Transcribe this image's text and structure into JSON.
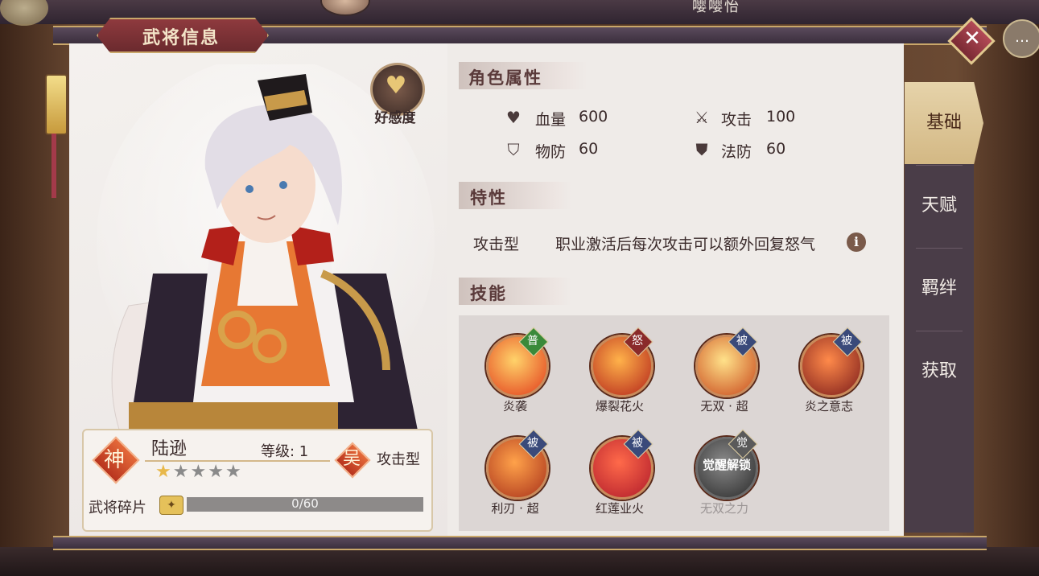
{
  "window": {
    "title": "武将信息",
    "top_name": "嘤嘤怡"
  },
  "hero": {
    "favor_label": "好感度",
    "rank_char": "神",
    "name": "陆逊",
    "level_text": "等级: 1",
    "stars_total": 5,
    "stars_filled": 1,
    "faction_char": "吴",
    "role_type": "攻击型",
    "fragment_label": "武将碎片",
    "fragment_progress": "0/60"
  },
  "attributes": {
    "section_title": "角色属性",
    "items": [
      {
        "icon": "heart-icon",
        "label": "血量",
        "value": "600"
      },
      {
        "icon": "sword-icon",
        "label": "攻击",
        "value": "100"
      },
      {
        "icon": "shield-icon",
        "label": "物防",
        "value": "60"
      },
      {
        "icon": "magic-shield-icon",
        "label": "法防",
        "value": "60"
      }
    ]
  },
  "trait": {
    "section_title": "特性",
    "name": "攻击型",
    "description": "职业激活后每次攻击可以额外回复怒气",
    "info_glyph": "i"
  },
  "skills": {
    "section_title": "技能",
    "items": [
      {
        "name": "炎袭",
        "badge": "普",
        "badge_color": "#3a8a3a",
        "colors": [
          "#ffd36a",
          "#e23a1a"
        ],
        "locked": false
      },
      {
        "name": "爆裂花火",
        "badge": "怒",
        "badge_color": "#8a2a2a",
        "colors": [
          "#ffb24a",
          "#b3231a"
        ],
        "locked": false
      },
      {
        "name": "无双 · 超",
        "badge": "被",
        "badge_color": "#3a4a7a",
        "colors": [
          "#ffe28a",
          "#c8461a"
        ],
        "locked": false
      },
      {
        "name": "炎之意志",
        "badge": "被",
        "badge_color": "#3a4a7a",
        "colors": [
          "#ff8a4a",
          "#7a1a1a"
        ],
        "locked": false
      },
      {
        "name": "利刃 · 超",
        "badge": "被",
        "badge_color": "#3a4a7a",
        "colors": [
          "#ffa24a",
          "#a8301a"
        ],
        "locked": false
      },
      {
        "name": "红莲业火",
        "badge": "被",
        "badge_color": "#3a4a7a",
        "colors": [
          "#ff6a4a",
          "#b01a2a"
        ],
        "locked": false
      },
      {
        "name": "无双之力",
        "badge": "觉",
        "badge_color": "#5a5a5a",
        "colors": [
          "#8a8a8a",
          "#2a2a2a"
        ],
        "locked": true,
        "overlay": "觉醒解锁"
      }
    ]
  },
  "tabs": [
    {
      "label": "基础",
      "active": true
    },
    {
      "label": "天赋",
      "active": false
    },
    {
      "label": "羁绊",
      "active": false
    },
    {
      "label": "获取",
      "active": false
    }
  ],
  "colors": {
    "accent_gold": "#c9a76a",
    "ribbon_red": "#8e3a3e",
    "panel_bg": "#efebe8"
  }
}
